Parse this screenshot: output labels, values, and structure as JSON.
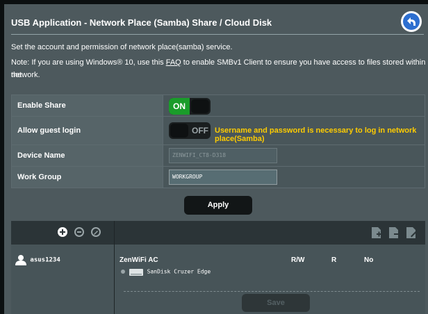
{
  "header": {
    "title": "USB Application - Network Place (Samba) Share / Cloud Disk",
    "back_icon": "back-arrow-icon"
  },
  "intro": {
    "line1": "Set the account and permission of network place(samba) service.",
    "note_prefix": "Note: If you are using Windows® 10, use this ",
    "note_link": "FAQ",
    "note_suffix": " to enable SMBv1 Client to ensure you have access to files stored within the",
    "note_line2": "network."
  },
  "settings": {
    "enable_share": {
      "label": "Enable Share",
      "state": "ON"
    },
    "allow_guest": {
      "label": "Allow guest login",
      "state": "OFF",
      "hint": "Username and password is necessary to log in network place(Samba)"
    },
    "device_name": {
      "label": "Device Name",
      "value": "ZENWIFI_CT8-D318"
    },
    "work_group": {
      "label": "Work Group",
      "value": "WORKGROUP"
    }
  },
  "apply_label": "Apply",
  "accounts": {
    "add_icon": "add-circle-icon",
    "remove_icon": "remove-circle-icon",
    "edit_icon": "edit-circle-icon",
    "users": [
      {
        "name": "asus1234",
        "icon": "user-icon"
      }
    ]
  },
  "folders": {
    "tool_icons": [
      "add-folder-icon",
      "delete-folder-icon",
      "rename-folder-icon"
    ],
    "share_name": "ZenWiFi AC",
    "columns": [
      "R/W",
      "R",
      "No"
    ],
    "drive": {
      "name": "SanDisk Cruzer Edge",
      "icon": "usb-drive-icon"
    }
  },
  "save_label": "Save",
  "colors": {
    "background": "#4d595d",
    "on_green": "#1a9c2a",
    "hint_yellow": "#ffcc00",
    "back_blue": "#2d6fd0"
  }
}
